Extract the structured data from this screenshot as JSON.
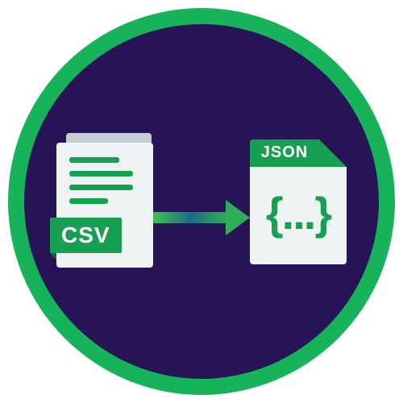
{
  "source": {
    "format_label": "CSV"
  },
  "target": {
    "format_label": "JSON",
    "content_glyph": "{...}"
  },
  "colors": {
    "ring": "#17b35a",
    "background": "#261456",
    "accent": "#17a052",
    "page": "#eff2f3"
  }
}
